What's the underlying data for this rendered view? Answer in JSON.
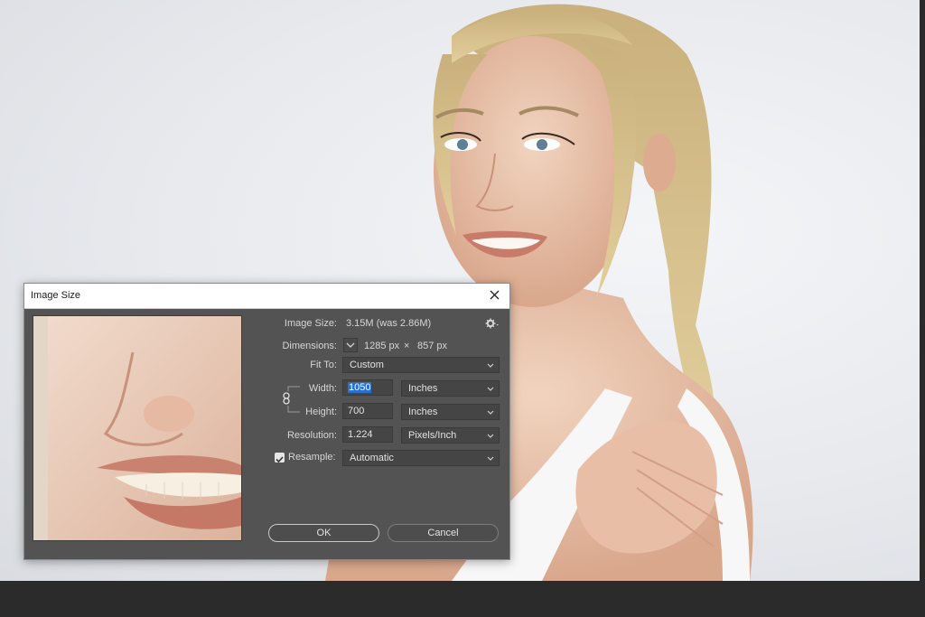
{
  "dialog": {
    "title": "Image Size",
    "image_size_label": "Image Size:",
    "image_size_value": "3.15M (was 2.86M)",
    "dimensions_label": "Dimensions:",
    "dimensions_width": "1285 px",
    "dimensions_times": "×",
    "dimensions_height": "857 px",
    "fit_to_label": "Fit To:",
    "fit_to_value": "Custom",
    "width_label": "Width:",
    "width_value": "1050",
    "width_unit": "Inches",
    "height_label": "Height:",
    "height_value": "700",
    "height_unit": "Inches",
    "resolution_label": "Resolution:",
    "resolution_value": "1.224",
    "resolution_unit": "Pixels/Inch",
    "resample_label": "Resample:",
    "resample_checked": true,
    "resample_value": "Automatic",
    "ok_label": "OK",
    "cancel_label": "Cancel"
  },
  "icons": {
    "close": "close-icon",
    "settings": "gear-icon",
    "dimensions_toggle": "chevron-down-icon",
    "constrain": "link-icon",
    "dropdown": "chevron-down-icon",
    "checkbox": "checkmark-icon"
  },
  "colors": {
    "dialog_bg": "#535353",
    "field_bg": "#454545",
    "selection": "#2a6ecf",
    "titlebar_bg": "#ffffff"
  }
}
